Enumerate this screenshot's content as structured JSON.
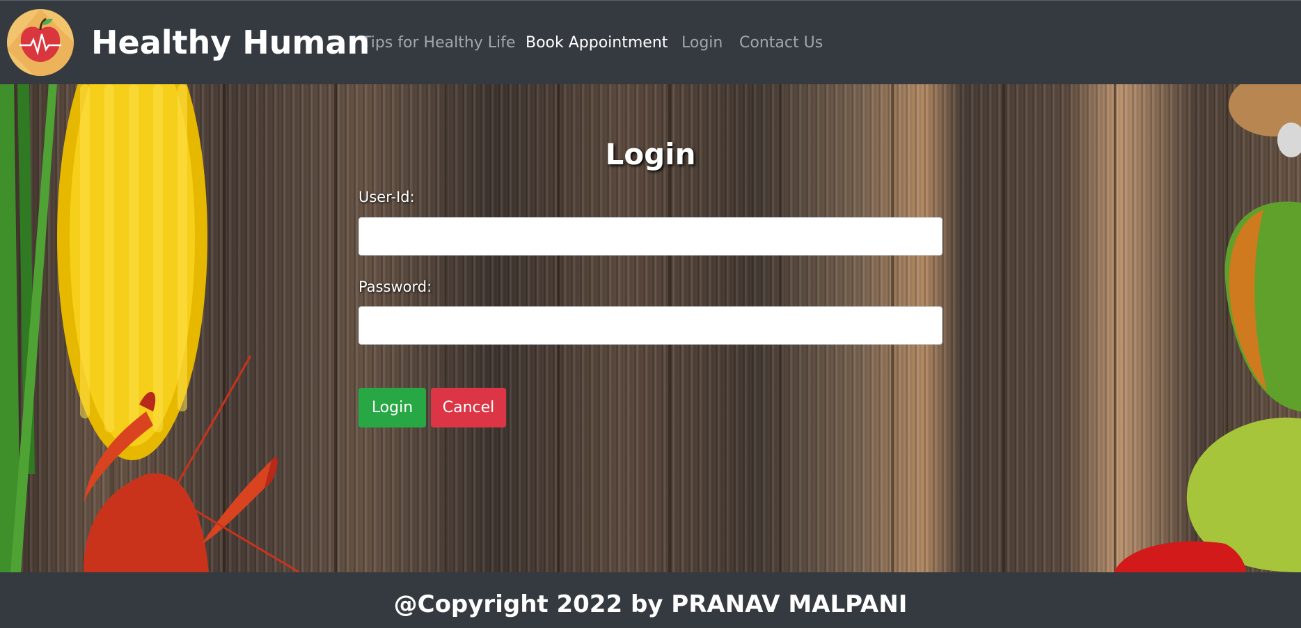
{
  "navbar": {
    "brand": "Healthy Human",
    "links": [
      {
        "label": "Tips for Healthy Life",
        "active": false
      },
      {
        "label": "Book Appointment",
        "active": true
      },
      {
        "label": "Login",
        "active": false
      },
      {
        "label": "Contact Us",
        "active": false
      }
    ],
    "logo_icon": "apple-heartbeat-icon"
  },
  "form": {
    "title": "Login",
    "userid_label": "User-Id:",
    "userid_value": "",
    "password_label": "Password:",
    "password_value": "",
    "login_button": "Login",
    "cancel_button": "Cancel"
  },
  "footer": {
    "text": "@Copyright 2022 by PRANAV MALPANI"
  },
  "colors": {
    "navbar_bg": "#343a40",
    "login_button": "#28a745",
    "cancel_button": "#dc3545",
    "logo_bg": "#f3c46e"
  }
}
